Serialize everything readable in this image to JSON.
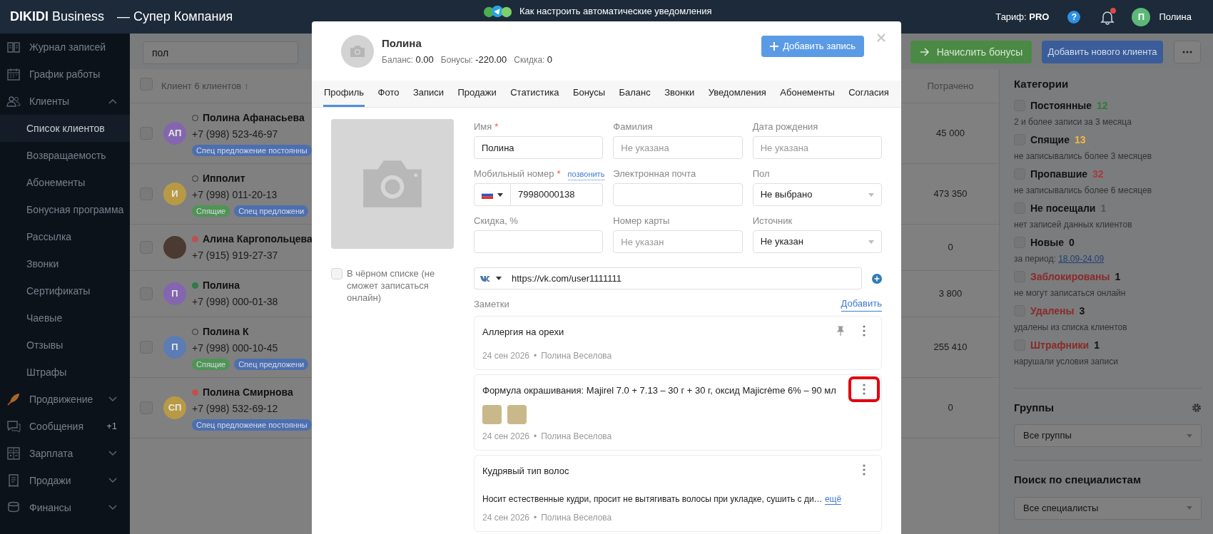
{
  "top_bar": {
    "logo": "DIKIDI",
    "logo_suffix": "Business",
    "company": "— Супер Компания",
    "promo": "Как настроить автоматические уведомления",
    "tariff_label": "Тариф:",
    "tariff": "PRO",
    "help": "?",
    "notifications_unread": true,
    "user_initial": "П",
    "user_name": "Полина"
  },
  "sidebar": {
    "items": [
      {
        "label": "Журнал записей"
      },
      {
        "label": "График работы"
      },
      {
        "label": "Клиенты",
        "expanded": true,
        "children": [
          {
            "label": "Список клиентов",
            "selected": true
          },
          {
            "label": "Возвращаемость",
            "selected": false
          },
          {
            "label": "Абонементы",
            "selected": false
          },
          {
            "label": "Бонусная программа",
            "selected": false
          },
          {
            "label": "Рассылка",
            "selected": false
          },
          {
            "label": "Звонки",
            "selected": false
          },
          {
            "label": "Сертификаты",
            "selected": false
          },
          {
            "label": "Чаевые",
            "selected": false
          },
          {
            "label": "Отзывы",
            "selected": false
          },
          {
            "label": "Штрафы",
            "selected": false
          }
        ]
      },
      {
        "label": "Продвижение",
        "expanded": false
      },
      {
        "label": "Сообщения",
        "badge": "+1"
      },
      {
        "label": "Зарплата",
        "expanded": false
      },
      {
        "label": "Продажи",
        "expanded": false
      },
      {
        "label": "Финансы",
        "expanded": false
      }
    ]
  },
  "clients": {
    "search": {
      "value": "пол"
    },
    "select_all_checked": false,
    "column_1": "Клиент 6 клиентов ↑",
    "spent_header": "Потрачено",
    "rows": [
      {
        "checked": false,
        "avatar": {
          "kind": "initials",
          "initials": "АП",
          "color": "#8466b0"
        },
        "status": {
          "kind": "empty"
        },
        "name": "Полина Афанасьева",
        "phone": "+7 (998) 523-46-97",
        "tags": [
          {
            "label": "Спец предложение постоянны",
            "color": "#4d6fb0"
          }
        ],
        "spent": "45 000"
      },
      {
        "checked": false,
        "avatar": {
          "kind": "initials",
          "initials": "И",
          "color": "#b89a45"
        },
        "status": {
          "kind": "empty"
        },
        "name": "Ипполит",
        "phone": "+7 (998) 011-20-13",
        "tags": [
          {
            "label": "Спящие",
            "color": "#4f9454"
          },
          {
            "label": "Спец предложени",
            "color": "#4d6fb0"
          }
        ],
        "spent": "473 350"
      },
      {
        "checked": false,
        "avatar": {
          "kind": "photo"
        },
        "status": {
          "kind": "dot",
          "color": "#c05050"
        },
        "name": "Алина Каргопольцева",
        "phone": "+7 (915) 919-27-37",
        "tags": [],
        "spent": "0"
      },
      {
        "checked": false,
        "avatar": {
          "kind": "initials",
          "initials": "П",
          "color": "#8466b0"
        },
        "status": {
          "kind": "dot",
          "color": "#2f7a45"
        },
        "name": "Полина",
        "phone": "+7 (998) 000-01-38",
        "tags": [],
        "spent": "3 800"
      },
      {
        "checked": false,
        "avatar": {
          "kind": "initials",
          "initials": "П",
          "color": "#5b7cb5"
        },
        "status": {
          "kind": "empty"
        },
        "name": "Полина К",
        "phone": "+7 (998) 000-10-45",
        "tags": [
          {
            "label": "Спящие",
            "color": "#4f9454"
          },
          {
            "label": "Спец предложени",
            "color": "#4d6fb0"
          }
        ],
        "spent": "255 410"
      },
      {
        "checked": false,
        "avatar": {
          "kind": "initials",
          "initials": "СП",
          "color": "#b89a45"
        },
        "status": {
          "kind": "dot",
          "color": "#c05050"
        },
        "name": "Полина Смирнова",
        "phone": "+7 (998) 532-69-12",
        "tags": [
          {
            "label": "Спец предложение постоянны",
            "color": "#4d6fb0"
          }
        ],
        "spent": "0"
      }
    ]
  },
  "actions": {
    "bonus_button": "Начислить бонусы",
    "new_client_button": "Добавить нового клиента"
  },
  "categories": {
    "title": "Категории",
    "items": [
      {
        "checked": false,
        "kind": "normal",
        "name": "Постоянные",
        "count": "12",
        "color": "#2f7a3f",
        "description": "2 и более записи за 3 месяца"
      },
      {
        "checked": false,
        "kind": "normal",
        "name": "Спящие",
        "count": "13",
        "color": "#f5b83c",
        "description": "не записывались более 3 месяцев"
      },
      {
        "checked": false,
        "kind": "normal",
        "name": "Пропавшие",
        "count": "32",
        "color": "#a83c3c",
        "description": "не записывались более 6 месяцев"
      },
      {
        "checked": false,
        "kind": "normal",
        "name": "Не посещали",
        "count": "1",
        "color": "#555555",
        "description": "нет записей данных клиентов"
      },
      {
        "checked": false,
        "kind": "normal",
        "name": "Новые",
        "count": "0",
        "color": "#111111",
        "description": "за период:",
        "link": "18.09-24.09"
      },
      {
        "checked": false,
        "kind": "restricted",
        "name": "Заблокированы",
        "count": "1",
        "color": "#111111",
        "description": "не могут записаться онлайн"
      },
      {
        "checked": false,
        "kind": "restricted",
        "name": "Удалены",
        "count": "3",
        "color": "#111111",
        "description": "удалены из списка клиентов"
      },
      {
        "checked": false,
        "kind": "restricted",
        "name": "Штрафники",
        "count": "1",
        "color": "#111111",
        "description": "нарушали условия записи"
      }
    ]
  },
  "groups": {
    "title": "Группы",
    "select": "Все группы"
  },
  "specialists": {
    "title": "Поиск по специалистам",
    "select": "Все специалисты"
  },
  "modal": {
    "name": "Полина",
    "stats": [
      {
        "label": "Баланс:",
        "value": "0.00"
      },
      {
        "label": "Бонусы:",
        "value": "-220.00"
      },
      {
        "label": "Скидка:",
        "value": "0"
      }
    ],
    "add_button": "Добавить запись",
    "tabs": [
      {
        "label": "Профиль",
        "selected": true
      },
      {
        "label": "Фото",
        "selected": false
      },
      {
        "label": "Записи",
        "selected": false
      },
      {
        "label": "Продажи",
        "selected": false
      },
      {
        "label": "Статистика",
        "selected": false
      },
      {
        "label": "Бонусы",
        "selected": false
      },
      {
        "label": "Баланс",
        "selected": false
      },
      {
        "label": "Звонки",
        "selected": false
      },
      {
        "label": "Уведомления",
        "selected": false
      },
      {
        "label": "Абонементы",
        "selected": false
      },
      {
        "label": "Согласия",
        "selected": false
      }
    ],
    "fields": [
      {
        "kind": "text",
        "label": "Имя",
        "required_mark": "*",
        "value": "Полина"
      },
      {
        "kind": "text",
        "label": "Фамилия",
        "placeholder": "Не указана"
      },
      {
        "kind": "text",
        "label": "Дата рождения",
        "placeholder": "Не указана"
      },
      {
        "kind": "phone",
        "label": "Мобильный номер",
        "required_mark": "*",
        "link": "позвонить",
        "value": "79980000138"
      },
      {
        "kind": "text",
        "label": "Электронная почта"
      },
      {
        "kind": "select",
        "label": "Пол",
        "value": "Не выбрано"
      },
      {
        "kind": "text",
        "label": "Скидка, %"
      },
      {
        "kind": "text",
        "label": "Номер карты",
        "placeholder": "Не указан"
      },
      {
        "kind": "select",
        "label": "Источник",
        "value": "Не указан"
      }
    ],
    "blacklist": {
      "label": "В чёрном списке (не сможет записаться онлайн)",
      "checked": false
    },
    "social": {
      "value": "https://vk.com/user1111111"
    },
    "notes": {
      "title": "Заметки",
      "add": "Добавить",
      "items": [
        {
          "text": "Аллергия на орехи",
          "pinned": true,
          "highlighted": false,
          "date": "24 сен 2026",
          "separator": "•",
          "author": "Полина Веселова"
        },
        {
          "text": "Формула окрашивания: Majirel 7.0 + 7.13 – 30 г + 30 г, оксид Majicrème 6% – 90 мл",
          "pinned": false,
          "highlighted": true,
          "attachments": [
            {
              "kind": "photo"
            },
            {
              "kind": "photo"
            }
          ],
          "date": "24 сен 2026",
          "separator": "•",
          "author": "Полина Веселова"
        },
        {
          "text": "Кудрявый тип волос",
          "body": "Носит естественные кудри, просит не вытягивать волосы при укладке, сушить с ди…",
          "more": "ещё",
          "pinned": false,
          "highlighted": false,
          "date": "24 сен 2026",
          "separator": "•",
          "author": "Полина Веселова"
        }
      ]
    }
  }
}
